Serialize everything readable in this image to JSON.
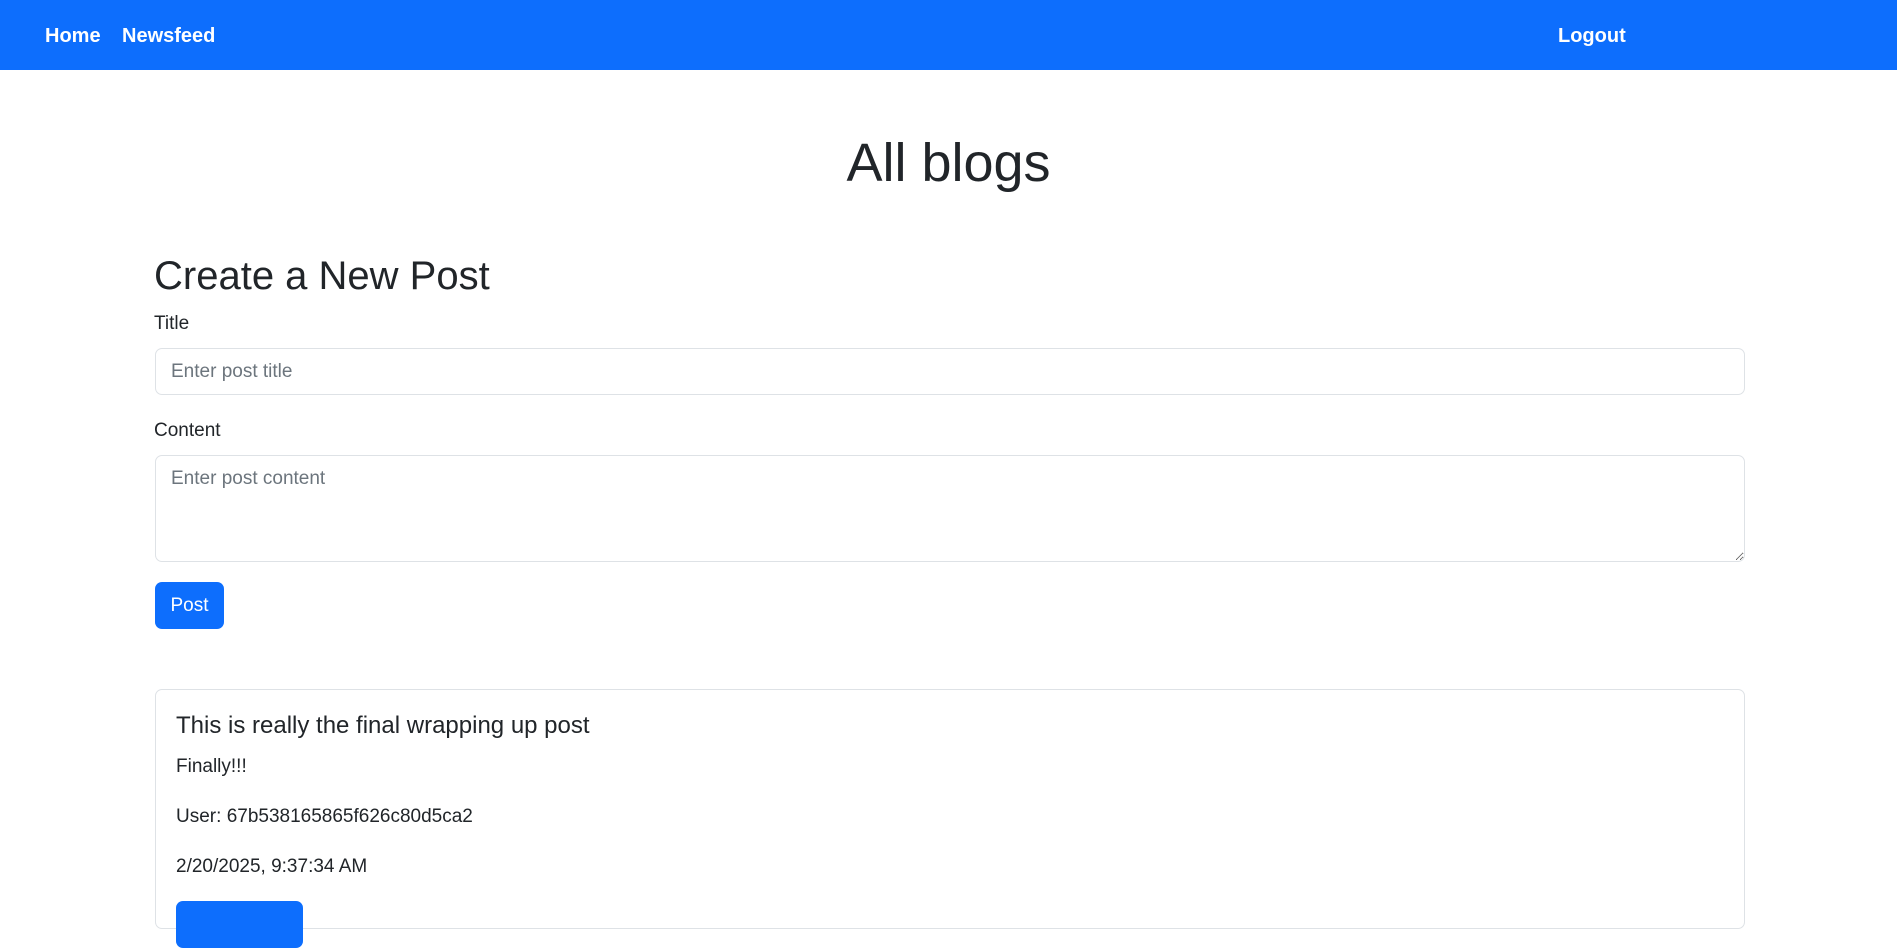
{
  "nav": {
    "home": "Home",
    "newsfeed": "Newsfeed",
    "logout": "Logout"
  },
  "page": {
    "title": "All blogs"
  },
  "create_form": {
    "heading": "Create a New Post",
    "title_label": "Title",
    "title_placeholder": "Enter post title",
    "title_value": "",
    "content_label": "Content",
    "content_placeholder": "Enter post content",
    "content_value": "",
    "submit_label": "Post"
  },
  "posts": [
    {
      "title": "This is really the final wrapping up post",
      "content": "Finally!!!",
      "user_prefix": "User: ",
      "user_id": "67b538165865f626c80d5ca2",
      "date": "2/20/2025, 9:37:34 AM"
    }
  ],
  "colors": {
    "primary": "#0d6efd",
    "text": "#212529",
    "border": "#dee2e6"
  }
}
